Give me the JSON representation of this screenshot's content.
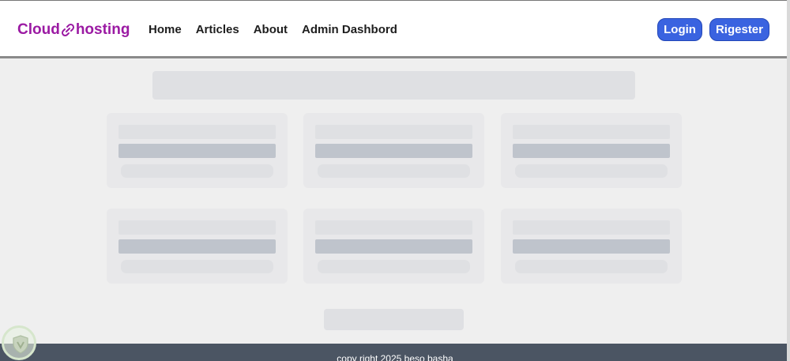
{
  "brand": {
    "name_prefix": "Cloud",
    "name_suffix": "hosting",
    "icon": "link-icon",
    "color": "#9b1aa3"
  },
  "nav": {
    "links": [
      {
        "label": "Home"
      },
      {
        "label": "Articles"
      },
      {
        "label": "About"
      },
      {
        "label": "Admin Dashbord"
      }
    ]
  },
  "auth": {
    "login_label": "Login",
    "register_label": "Rigester",
    "button_color": "#3a63e0"
  },
  "footer": {
    "text": "copy right 2025 beso basha",
    "background": "#4b5563"
  },
  "overlay": {
    "icon": "shield-icon"
  }
}
